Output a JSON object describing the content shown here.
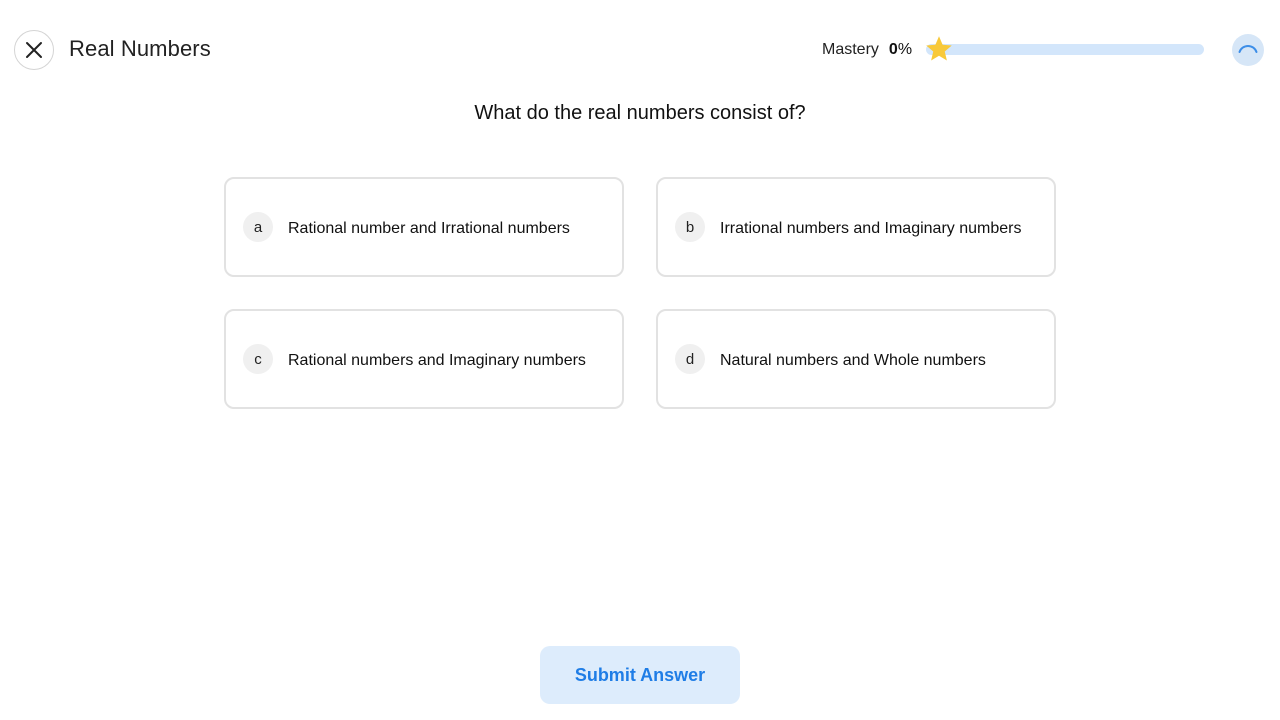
{
  "header": {
    "title": "Real Numbers",
    "close_icon": "close-icon"
  },
  "mastery": {
    "label": "Mastery",
    "value": "0",
    "percent_sign": "%",
    "progress_fraction": 0,
    "star_icon": "star-icon",
    "star_color": "#f8c93a",
    "track_color": "#d3e6fb"
  },
  "status": {
    "loader_icon": "loading-spinner-icon"
  },
  "question": {
    "text": "What do the real numbers consist of?"
  },
  "options": [
    {
      "letter": "a",
      "text": "Rational number and Irrational numbers"
    },
    {
      "letter": "b",
      "text": "Irrational numbers and Imaginary numbers"
    },
    {
      "letter": "c",
      "text": "Rational numbers and Imaginary numbers"
    },
    {
      "letter": "d",
      "text": "Natural numbers and Whole numbers"
    }
  ],
  "submit": {
    "label": "Submit Answer",
    "accent": "#1f7de6",
    "background": "#ddecfc"
  }
}
